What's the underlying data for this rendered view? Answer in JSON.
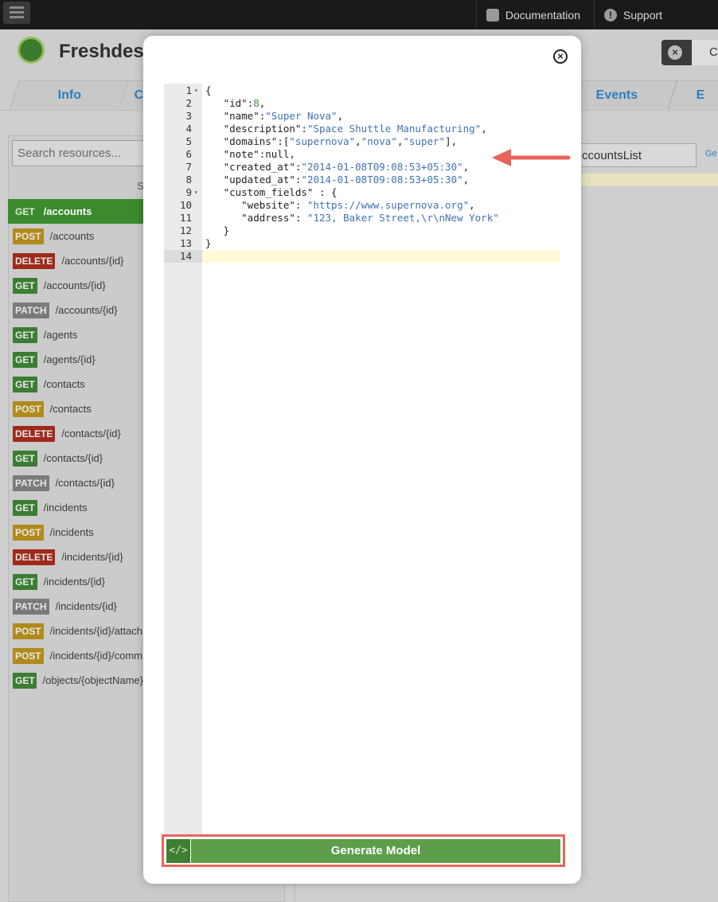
{
  "topbar": {
    "documentation_label": "Documentation",
    "support_label": "Support"
  },
  "header": {
    "brand": "Freshdes",
    "close_partial": "C"
  },
  "tabs": [
    {
      "label": "Info"
    },
    {
      "label": "C"
    },
    {
      "label": "Events"
    },
    {
      "label": "E"
    }
  ],
  "sidebar": {
    "search_placeholder": "Search resources...",
    "section_label": "S",
    "items": [
      {
        "verb": "GET",
        "path": "/accounts",
        "active": true
      },
      {
        "verb": "POST",
        "path": "/accounts"
      },
      {
        "verb": "DELETE",
        "path": "/accounts/{id}"
      },
      {
        "verb": "GET",
        "path": "/accounts/{id}"
      },
      {
        "verb": "PATCH",
        "path": "/accounts/{id}"
      },
      {
        "verb": "GET",
        "path": "/agents"
      },
      {
        "verb": "GET",
        "path": "/agents/{id}"
      },
      {
        "verb": "GET",
        "path": "/contacts"
      },
      {
        "verb": "POST",
        "path": "/contacts"
      },
      {
        "verb": "DELETE",
        "path": "/contacts/{id}"
      },
      {
        "verb": "GET",
        "path": "/contacts/{id}"
      },
      {
        "verb": "PATCH",
        "path": "/contacts/{id}"
      },
      {
        "verb": "GET",
        "path": "/incidents"
      },
      {
        "verb": "POST",
        "path": "/incidents"
      },
      {
        "verb": "DELETE",
        "path": "/incidents/{id}"
      },
      {
        "verb": "GET",
        "path": "/incidents/{id}"
      },
      {
        "verb": "PATCH",
        "path": "/incidents/{id}"
      },
      {
        "verb": "POST",
        "path": "/incidents/{id}/attach"
      },
      {
        "verb": "POST",
        "path": "/incidents/{id}/comm"
      },
      {
        "verb": "GET",
        "path": "/objects/{objectName}"
      }
    ]
  },
  "rightpane": {
    "input_value": "ccountsList",
    "link_partial": "Ge"
  },
  "modal": {
    "close_symbol": "×",
    "generate_label": "Generate Model",
    "generate_icon_text": "</>",
    "code_lines": [
      {
        "n": "1",
        "fold": true,
        "parts": [
          [
            "k",
            "{"
          ]
        ]
      },
      {
        "n": "2",
        "parts": [
          [
            "k",
            "   \"id\":"
          ],
          [
            "n",
            "8"
          ],
          [
            "k",
            ","
          ]
        ]
      },
      {
        "n": "3",
        "parts": [
          [
            "k",
            "   \"name\":"
          ],
          [
            "s",
            "\"Super Nova\""
          ],
          [
            "k",
            ","
          ]
        ]
      },
      {
        "n": "4",
        "parts": [
          [
            "k",
            "   \"description\":"
          ],
          [
            "s",
            "\"Space Shuttle Manufacturing\""
          ],
          [
            "k",
            ","
          ]
        ]
      },
      {
        "n": "5",
        "parts": [
          [
            "k",
            "   \"domains\":["
          ],
          [
            "s",
            "\"supernova\""
          ],
          [
            "k",
            ","
          ],
          [
            "s",
            "\"nova\""
          ],
          [
            "k",
            ","
          ],
          [
            "s",
            "\"super\""
          ],
          [
            "k",
            "],"
          ]
        ]
      },
      {
        "n": "6",
        "parts": [
          [
            "k",
            "   \"note\":null,"
          ]
        ]
      },
      {
        "n": "7",
        "parts": [
          [
            "k",
            "   \"created_at\":"
          ],
          [
            "s",
            "\"2014-01-08T09:08:53+05:30\""
          ],
          [
            "k",
            ","
          ]
        ]
      },
      {
        "n": "8",
        "parts": [
          [
            "k",
            "   \"updated_at\":"
          ],
          [
            "s",
            "\"2014-01-08T09:08:53+05:30\""
          ],
          [
            "k",
            ","
          ]
        ]
      },
      {
        "n": "9",
        "fold": true,
        "parts": [
          [
            "k",
            "   \"custom_fields\" : {"
          ]
        ]
      },
      {
        "n": "10",
        "parts": [
          [
            "k",
            "      \"website\": "
          ],
          [
            "s",
            "\"https://www.supernova.org\""
          ],
          [
            "k",
            ","
          ]
        ]
      },
      {
        "n": "11",
        "parts": [
          [
            "k",
            "      \"address\": "
          ],
          [
            "s",
            "\"123, Baker Street,\\r\\nNew York\""
          ]
        ]
      },
      {
        "n": "12",
        "parts": [
          [
            "k",
            "   }"
          ]
        ]
      },
      {
        "n": "13",
        "parts": [
          [
            "k",
            "}"
          ]
        ]
      },
      {
        "n": "14",
        "current": true,
        "parts": []
      }
    ]
  },
  "colors": {
    "annotation_red": "#e8645a",
    "generate_green": "#5c9e4a",
    "active_green": "#3b8b2e"
  }
}
